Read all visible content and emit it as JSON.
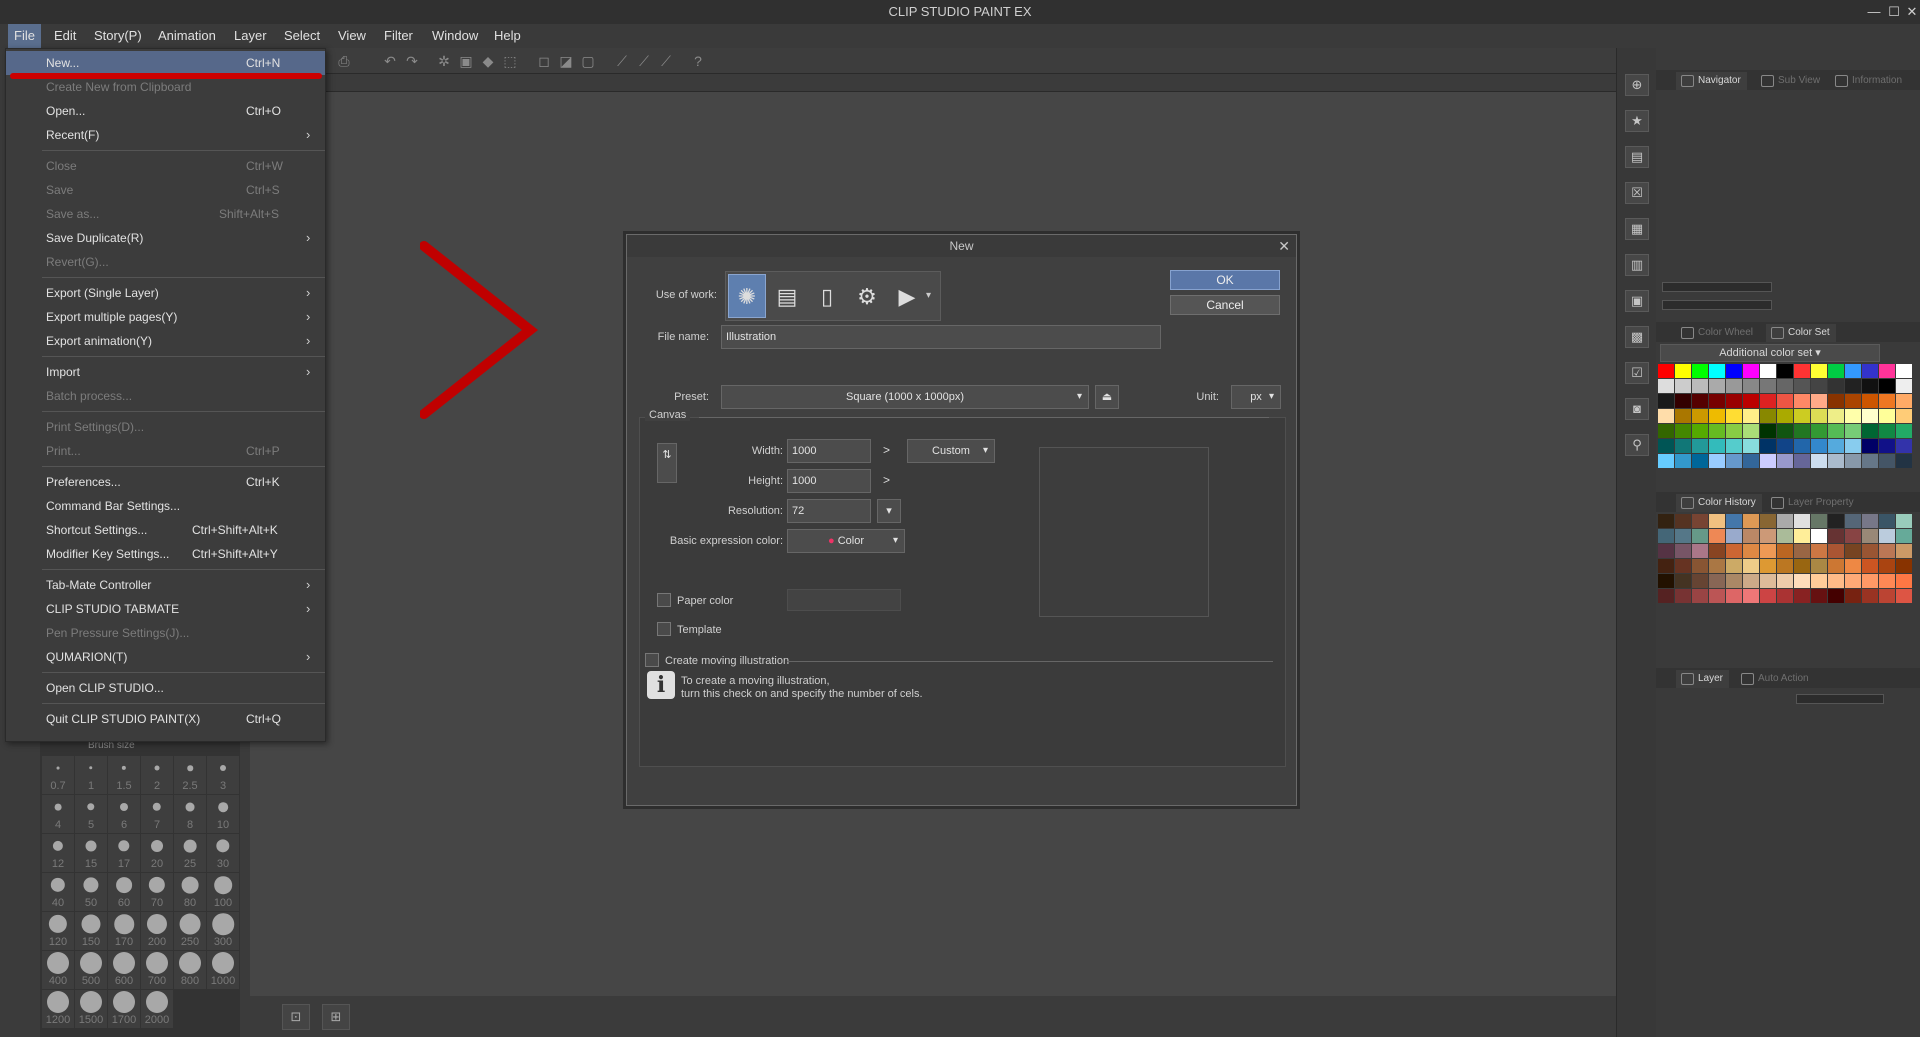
{
  "app": {
    "title": "CLIP STUDIO PAINT EX"
  },
  "window_controls": {
    "minimize": "—",
    "maximize": "☐",
    "close": "✕"
  },
  "menubar": [
    "File",
    "Edit",
    "Story(P)",
    "Animation",
    "Layer",
    "Select",
    "View",
    "Filter",
    "Window",
    "Help"
  ],
  "file_menu": [
    {
      "label": "New...",
      "shortcut": "Ctrl+N",
      "disabled": false,
      "submenu": false
    },
    {
      "label": "Create New from Clipboard",
      "shortcut": "",
      "disabled": true,
      "submenu": false
    },
    {
      "label": "Open...",
      "shortcut": "Ctrl+O",
      "disabled": false,
      "submenu": false
    },
    {
      "label": "Recent(F)",
      "shortcut": "",
      "disabled": false,
      "submenu": true
    },
    {
      "label": "Close",
      "shortcut": "Ctrl+W",
      "disabled": true,
      "submenu": false
    },
    {
      "label": "Save",
      "shortcut": "Ctrl+S",
      "disabled": true,
      "submenu": false
    },
    {
      "label": "Save as...",
      "shortcut": "Shift+Alt+S",
      "disabled": true,
      "submenu": false
    },
    {
      "label": "Save Duplicate(R)",
      "shortcut": "",
      "disabled": false,
      "submenu": true
    },
    {
      "label": "Revert(G)...",
      "shortcut": "",
      "disabled": true,
      "submenu": false
    },
    {
      "label": "Export (Single Layer)",
      "shortcut": "",
      "disabled": false,
      "submenu": true
    },
    {
      "label": "Export multiple pages(Y)",
      "shortcut": "",
      "disabled": false,
      "submenu": true
    },
    {
      "label": "Export animation(Y)",
      "shortcut": "",
      "disabled": false,
      "submenu": true
    },
    {
      "label": "Import",
      "shortcut": "",
      "disabled": false,
      "submenu": true
    },
    {
      "label": "Batch process...",
      "shortcut": "",
      "disabled": true,
      "submenu": false
    },
    {
      "label": "Print Settings(D)...",
      "shortcut": "",
      "disabled": true,
      "submenu": false
    },
    {
      "label": "Print...",
      "shortcut": "Ctrl+P",
      "disabled": true,
      "submenu": false
    },
    {
      "label": "Preferences...",
      "shortcut": "Ctrl+K",
      "disabled": false,
      "submenu": false
    },
    {
      "label": "Command Bar Settings...",
      "shortcut": "",
      "disabled": false,
      "submenu": false
    },
    {
      "label": "Shortcut Settings...",
      "shortcut": "Ctrl+Shift+Alt+K",
      "disabled": false,
      "submenu": false
    },
    {
      "label": "Modifier Key Settings...",
      "shortcut": "Ctrl+Shift+Alt+Y",
      "disabled": false,
      "submenu": false
    },
    {
      "label": "Tab-Mate Controller",
      "shortcut": "",
      "disabled": false,
      "submenu": true
    },
    {
      "label": "CLIP STUDIO TABMATE",
      "shortcut": "",
      "disabled": false,
      "submenu": true
    },
    {
      "label": "Pen Pressure Settings(J)...",
      "shortcut": "",
      "disabled": true,
      "submenu": false
    },
    {
      "label": "QUMARION(T)",
      "shortcut": "",
      "disabled": false,
      "submenu": true
    },
    {
      "label": "Open CLIP STUDIO...",
      "shortcut": "",
      "disabled": false,
      "submenu": false
    },
    {
      "label": "Quit CLIP STUDIO PAINT(X)",
      "shortcut": "Ctrl+Q",
      "disabled": false,
      "submenu": false
    }
  ],
  "dialog": {
    "title": "New",
    "close": "✕",
    "use_of_work_label": "Use of work:",
    "file_name_label": "File name:",
    "file_name_value": "Illustration",
    "preset_label": "Preset:",
    "preset_value": "Square (1000 x 1000px)",
    "unit_label": "Unit:",
    "unit_value": "px",
    "ok": "OK",
    "cancel": "Cancel",
    "canvas_legend": "Canvas",
    "width_label": "Width:",
    "width_value": "1000",
    "height_label": "Height:",
    "height_value": "1000",
    "size_select": "Custom",
    "resolution_label": "Resolution:",
    "resolution_value": "72",
    "basic_color_label": "Basic expression color:",
    "basic_color_value": "Color",
    "paper_color_label": "Paper color",
    "template_label": "Template",
    "moving_label": "Create moving illustration",
    "moving_info_1": "To create a moving illustration,",
    "moving_info_2": "turn this check on and specify the number of cels.",
    "chevron": ">"
  },
  "brush_panel": {
    "title": "Brush size",
    "sizes": [
      "0.7",
      "1",
      "1.5",
      "2",
      "2.5",
      "3",
      "4",
      "5",
      "6",
      "7",
      "8",
      "10",
      "12",
      "15",
      "17",
      "20",
      "25",
      "30",
      "40",
      "50",
      "60",
      "70",
      "80",
      "100",
      "120",
      "150",
      "170",
      "200",
      "250",
      "300",
      "400",
      "500",
      "600",
      "700",
      "800",
      "1000",
      "1200",
      "1500",
      "1700",
      "2000"
    ]
  },
  "right_panel": {
    "tabs_top": [
      "Navigator",
      "Sub View",
      "Information"
    ],
    "tabs_color": [
      "Color Wheel",
      "Color Set"
    ],
    "colorset_select": "Additional color set",
    "tabs_history": [
      "Color History",
      "Layer Property"
    ],
    "tabs_layer": [
      "Layer",
      "Auto Action"
    ]
  },
  "colors": {
    "accent": "#5a77a8",
    "annotation_red": "#c00000"
  }
}
